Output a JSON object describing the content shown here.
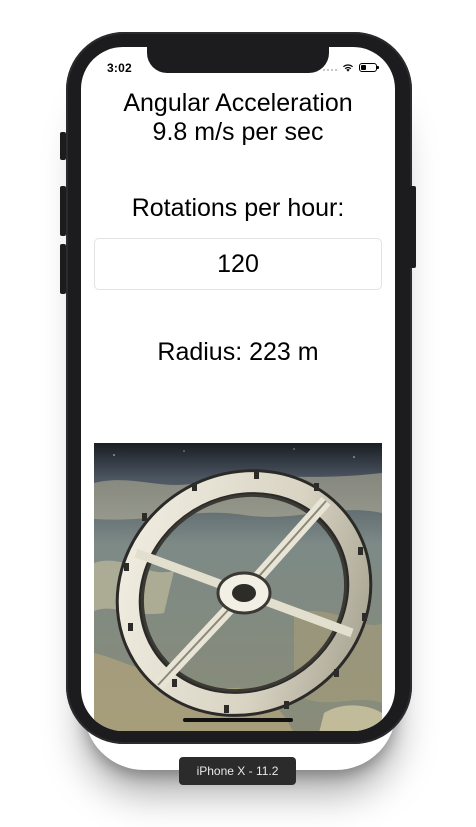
{
  "status_bar": {
    "time": "3:02"
  },
  "app": {
    "title_line1": "Angular Acceleration",
    "title_line2": "9.8 m/s per sec",
    "rotations_label": "Rotations per hour:",
    "rotations_value": "120",
    "radius_text": "Radius: 223 m"
  },
  "simulator": {
    "device_label": "iPhone X - 11.2"
  },
  "colors": {
    "device_body": "#1c1c1e",
    "screen_background": "#ffffff",
    "text": "#000000",
    "input_border": "#e3e3e3"
  },
  "icons": {
    "signal": "cellular-signal-icon",
    "wifi": "wifi-icon",
    "battery": "battery-icon"
  }
}
